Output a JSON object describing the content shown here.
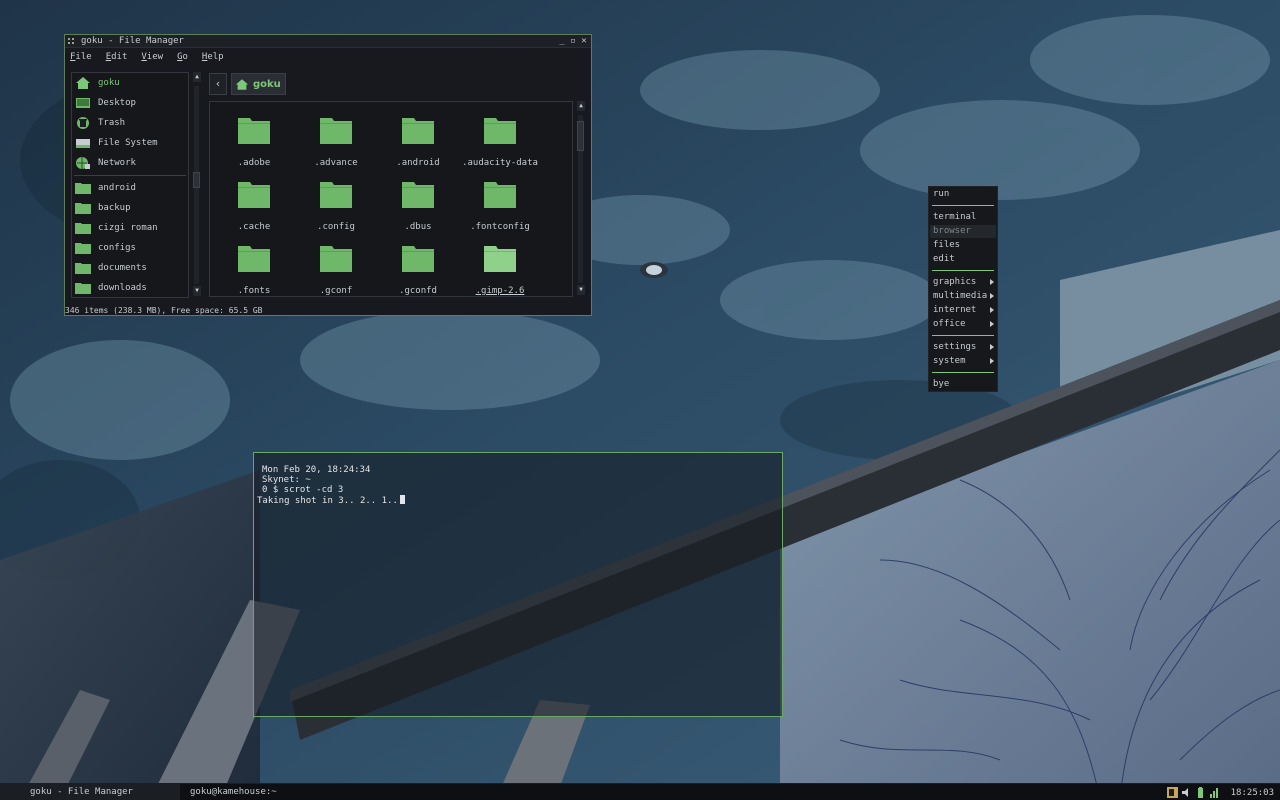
{
  "file_manager": {
    "title": "goku - File Manager",
    "menu": [
      "File",
      "Edit",
      "View",
      "Go",
      "Help"
    ],
    "sidebar": {
      "places": [
        {
          "label": "goku",
          "icon": "home-icon"
        },
        {
          "label": "Desktop",
          "icon": "desktop-icon"
        },
        {
          "label": "Trash",
          "icon": "trash-icon"
        },
        {
          "label": "File System",
          "icon": "drive-icon"
        },
        {
          "label": "Network",
          "icon": "network-icon"
        }
      ],
      "bookmarks": [
        {
          "label": "android",
          "icon": "folder-icon"
        },
        {
          "label": "backup",
          "icon": "folder-icon"
        },
        {
          "label": "cizgi roman",
          "icon": "folder-icon"
        },
        {
          "label": "configs",
          "icon": "folder-icon"
        },
        {
          "label": "documents",
          "icon": "folder-icon"
        },
        {
          "label": "downloads",
          "icon": "folder-icon"
        }
      ]
    },
    "breadcrumb": "goku",
    "files": [
      ".adobe",
      ".advance",
      ".android",
      ".audacity-data",
      ".cache",
      ".config",
      ".dbus",
      ".fontconfig",
      ".fonts",
      ".gconf",
      ".gconfd",
      ".gimp-2.6"
    ],
    "status": "346 items (238.3 MB), Free space: 65.5 GB"
  },
  "root_menu": {
    "title": "run",
    "items": [
      "terminal",
      "browser",
      "files",
      "edit"
    ],
    "submenus": [
      "graphics",
      "multimedia",
      "internet",
      "office"
    ],
    "system": [
      "settings",
      "system"
    ],
    "exit": "bye"
  },
  "terminal": {
    "lines": [
      "Mon Feb 20, 18:24:34",
      "Skynet: ~",
      "0 $ scrot -cd 3",
      "Taking shot in 3.. 2.. 1.."
    ]
  },
  "taskbar": {
    "tasks": [
      "goku - File Manager",
      "goku@kamehouse:~"
    ],
    "clock": "18:25:03"
  },
  "colors": {
    "accent": "#7ec67a",
    "folder": "#6fb86a",
    "window_bg": "#17191e",
    "border": "#5f7d59"
  }
}
